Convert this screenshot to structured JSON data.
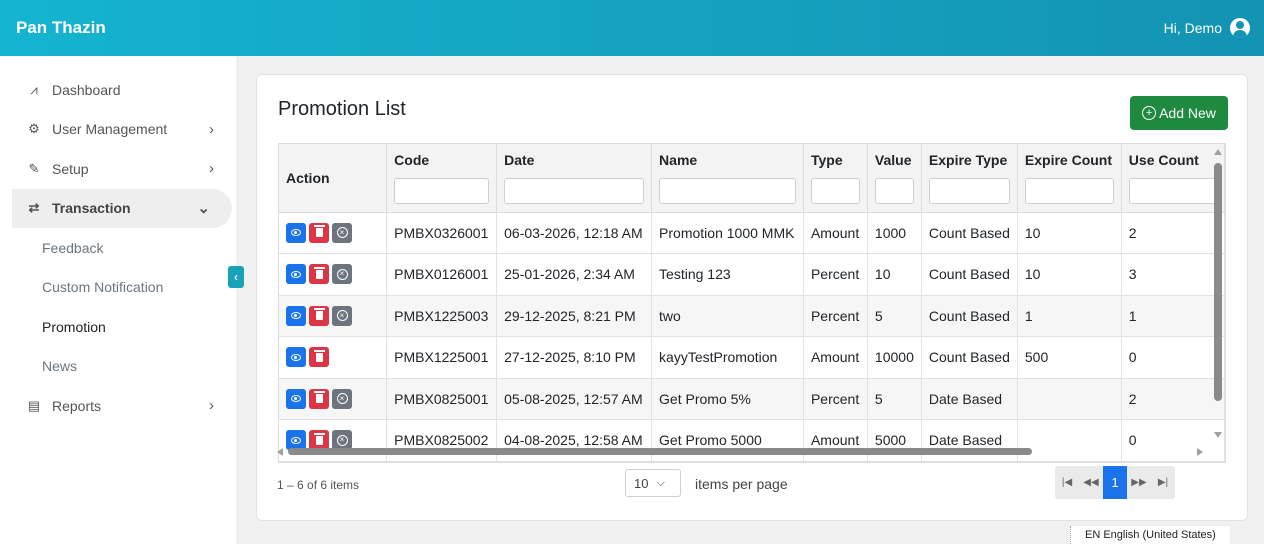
{
  "app": {
    "brand": "Pan Thazin",
    "greeting": "Hi, Demo"
  },
  "sidebar": {
    "items": [
      {
        "label": "Dashboard",
        "icon": "chart-line-icon",
        "glyph": "📈"
      },
      {
        "label": "User Management",
        "icon": "users-gear-icon",
        "glyph": "👥"
      },
      {
        "label": "Setup",
        "icon": "edit-icon",
        "glyph": "✎"
      },
      {
        "label": "Transaction",
        "icon": "exchange-icon",
        "glyph": "⇄"
      },
      {
        "label": "Reports",
        "icon": "file-icon",
        "glyph": "🗎"
      }
    ],
    "subitems": [
      "Feedback",
      "Custom Notification",
      "Promotion",
      "News"
    ]
  },
  "page": {
    "title": "Promotion List",
    "add_label": "Add New"
  },
  "table": {
    "columns": [
      "Action",
      "Code",
      "Date",
      "Name",
      "Type",
      "Value",
      "Expire Type",
      "Expire Count",
      "Use Count"
    ],
    "rows": [
      {
        "code": "PMBX0326001",
        "date": "06-03-2026, 12:18 AM",
        "name": "Promotion 1000 MMK",
        "type": "Amount",
        "value": "1000",
        "expire_type": "Count Based",
        "expire_count": "10",
        "use_count": "2"
      },
      {
        "code": "PMBX0126001",
        "date": "25-01-2026, 2:34 AM",
        "name": "Testing 123",
        "type": "Percent",
        "value": "10",
        "expire_type": "Count Based",
        "expire_count": "10",
        "use_count": "3"
      },
      {
        "code": "PMBX1225003",
        "date": "29-12-2025, 8:21 PM",
        "name": "two",
        "type": "Percent",
        "value": "5",
        "expire_type": "Count Based",
        "expire_count": "1",
        "use_count": "1"
      },
      {
        "code": "PMBX1225001",
        "date": "27-12-2025, 8:10 PM",
        "name": "kayyTestPromotion",
        "type": "Amount",
        "value": "10000",
        "expire_type": "Count Based",
        "expire_count": "500",
        "use_count": "0"
      },
      {
        "code": "PMBX0825001",
        "date": "05-08-2025, 12:57 AM",
        "name": "Get Promo 5%",
        "type": "Percent",
        "value": "5",
        "expire_type": "Date Based",
        "expire_count": "",
        "use_count": "2"
      },
      {
        "code": "PMBX0825002",
        "date": "04-08-2025, 12:58 AM",
        "name": "Get Promo 5000",
        "type": "Amount",
        "value": "5000",
        "expire_type": "Date Based",
        "expire_count": "",
        "use_count": "0"
      }
    ]
  },
  "pager": {
    "info": "1 – 6 of 6 items",
    "page_size": "10",
    "per_page_label": "items per page",
    "current_page": "1"
  },
  "taskbar": {
    "language": "EN English (United States)"
  },
  "colors": {
    "header": "#14b4cf",
    "add": "#1e8a3f",
    "view": "#1a73e8",
    "delete": "#dc3545",
    "cancel": "#6c757d"
  }
}
